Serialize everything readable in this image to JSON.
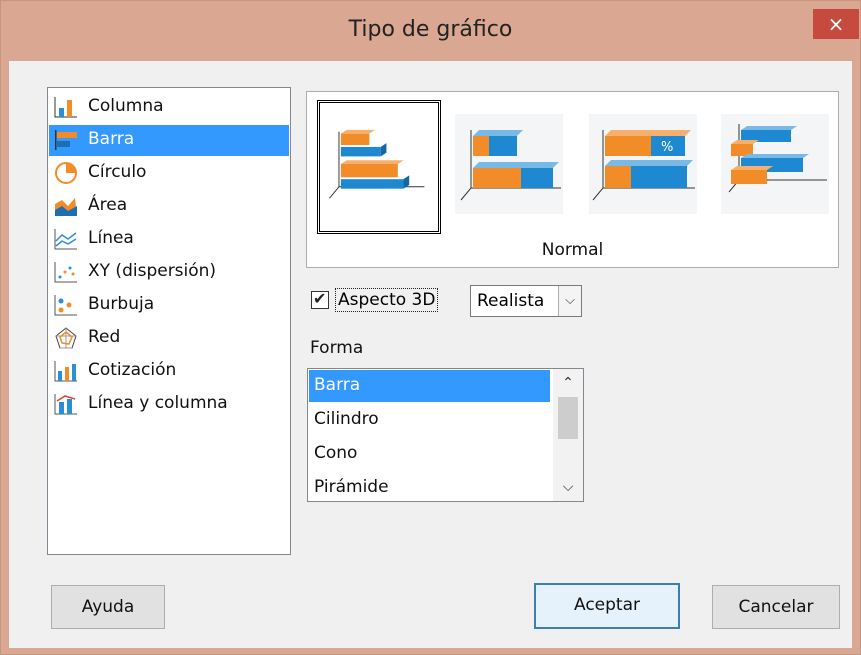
{
  "window": {
    "title": "Tipo de gráfico",
    "close_icon": "close-icon",
    "close_glyph": "×"
  },
  "chart_types": [
    {
      "label": "Columna",
      "icon": "column-chart-icon"
    },
    {
      "label": "Barra",
      "icon": "bar-chart-icon",
      "selected": true
    },
    {
      "label": "Círculo",
      "icon": "pie-chart-icon"
    },
    {
      "label": "Área",
      "icon": "area-chart-icon"
    },
    {
      "label": "Línea",
      "icon": "line-chart-icon"
    },
    {
      "label": "XY (dispersión)",
      "icon": "scatter-chart-icon"
    },
    {
      "label": "Burbuja",
      "icon": "bubble-chart-icon"
    },
    {
      "label": "Red",
      "icon": "net-chart-icon"
    },
    {
      "label": "Cotización",
      "icon": "stock-chart-icon"
    },
    {
      "label": "Línea y columna",
      "icon": "line-column-chart-icon"
    }
  ],
  "variants": {
    "selected_name": "Normal",
    "items": [
      {
        "icon": "bar-3d-normal-icon",
        "selected": true
      },
      {
        "icon": "bar-3d-stacked-icon"
      },
      {
        "icon": "bar-3d-percent-stacked-icon",
        "badge": "%"
      },
      {
        "icon": "bar-3d-deep-icon"
      }
    ]
  },
  "options": {
    "aspect3d": {
      "label": "Aspecto 3D",
      "checked": true,
      "check_glyph": "✔"
    },
    "scheme": {
      "value": "Realista",
      "arrow": "⌵"
    }
  },
  "shape": {
    "title": "Forma",
    "items": [
      "Barra",
      "Cilindro",
      "Cono",
      "Pirámide"
    ],
    "selected_index": 0,
    "scroll_up": "⌃",
    "scroll_down": "⌵"
  },
  "buttons": {
    "help": "Ayuda",
    "ok": "Aceptar",
    "cancel": "Cancelar"
  },
  "colors": {
    "accent": "#3399ff",
    "titlebar": "#d9a792",
    "close": "#c74a3f",
    "bar_orange": "#f28c28",
    "bar_blue": "#1e88d0"
  }
}
